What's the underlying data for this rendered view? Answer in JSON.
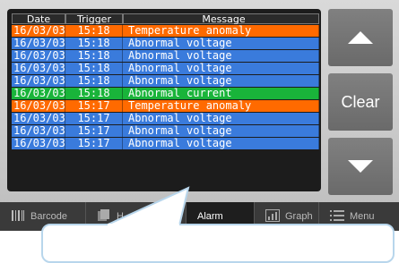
{
  "table": {
    "headers": [
      "Date",
      "Trigger",
      "Message"
    ],
    "rows": [
      {
        "date": "16/03/03",
        "trigger": "15:18",
        "message": "Temperature anomaly",
        "color": "#ff6a00"
      },
      {
        "date": "16/03/03",
        "trigger": "15:18",
        "message": "Abnormal voltage",
        "color": "#3a7bdc"
      },
      {
        "date": "16/03/03",
        "trigger": "15:18",
        "message": "Abnormal voltage",
        "color": "#3a7bdc"
      },
      {
        "date": "16/03/03",
        "trigger": "15:18",
        "message": "Abnormal voltage",
        "color": "#3a7bdc"
      },
      {
        "date": "16/03/03",
        "trigger": "15:18",
        "message": "Abnormal voltage",
        "color": "#3a7bdc"
      },
      {
        "date": "16/03/03",
        "trigger": "15:18",
        "message": "Abnormal current",
        "color": "#19b43a"
      },
      {
        "date": "16/03/03",
        "trigger": "15:17",
        "message": "Temperature anomaly",
        "color": "#ff6a00"
      },
      {
        "date": "16/03/03",
        "trigger": "15:17",
        "message": "Abnormal voltage",
        "color": "#3a7bdc"
      },
      {
        "date": "16/03/03",
        "trigger": "15:17",
        "message": "Abnormal voltage",
        "color": "#3a7bdc"
      },
      {
        "date": "16/03/03",
        "trigger": "15:17",
        "message": "Abnormal voltage",
        "color": "#3a7bdc"
      }
    ]
  },
  "side": {
    "up_icon": "triangle-up-icon",
    "clear_label": "Clear",
    "down_icon": "triangle-down-icon"
  },
  "tabs": [
    {
      "label": "Barcode",
      "icon": "barcode-icon"
    },
    {
      "label": "H",
      "icon": "history-icon"
    },
    {
      "label": "Alarm",
      "icon": "alarm-icon",
      "active": true
    },
    {
      "label": "Graph",
      "icon": "graph-icon"
    },
    {
      "label": "Menu",
      "icon": "menu-icon"
    }
  ]
}
